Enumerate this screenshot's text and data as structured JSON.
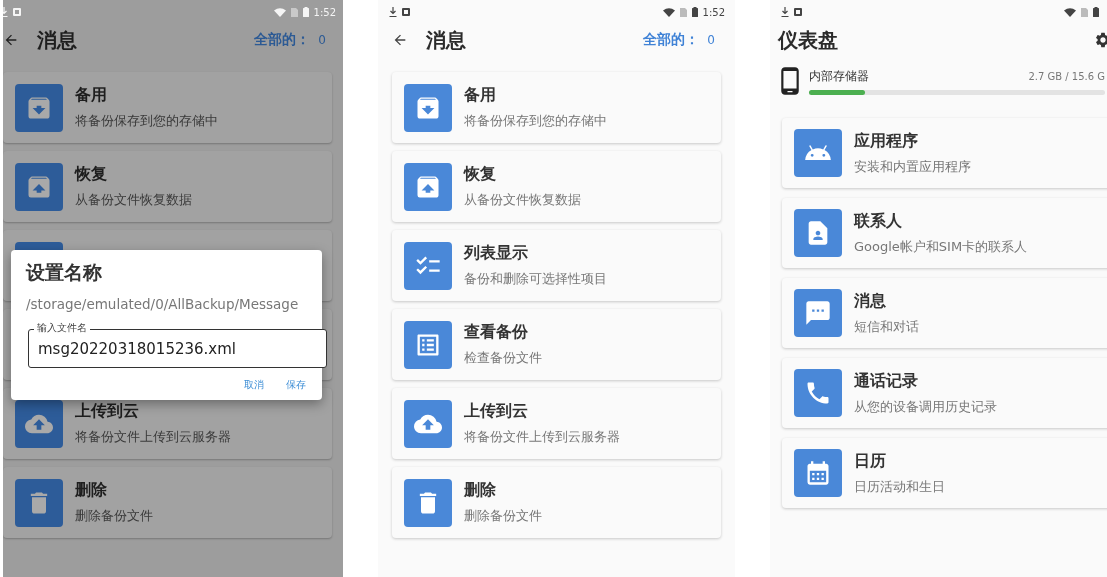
{
  "backup_screen_with_dialog": {
    "scrim": true,
    "status_bar": {
      "time": "1:52"
    },
    "header": {
      "title": "消息",
      "total_label": "全部的：",
      "total_value": "0"
    },
    "cards_above": [
      {
        "kind": "backup",
        "title": "备用",
        "subtitle": "将备份保存到您的存储中"
      },
      {
        "kind": "restore",
        "title": "恢复",
        "subtitle": "从备份文件恢复数据"
      }
    ],
    "cards_below": [
      {
        "kind": "upload",
        "title": "上传到云",
        "subtitle": "将备份文件上传到云服务器"
      },
      {
        "kind": "delete",
        "title": "删除",
        "subtitle": "删除备份文件"
      }
    ],
    "dialog": {
      "title": "设置名称",
      "path": "/storage/emulated/0/AllBackup/Message",
      "field": {
        "label": "输入文件名",
        "value": "msg20220318015236.xml"
      },
      "buttons": [
        "取消",
        "保存"
      ]
    }
  },
  "messages_screen": {
    "scrim": false,
    "status_bar": {
      "time": "1:52"
    },
    "header": {
      "title": "消息",
      "total_label": "全部的：",
      "total_value": "0"
    },
    "cards": [
      {
        "kind": "backup",
        "title": "备用",
        "subtitle": "将备份保存到您的存储中"
      },
      {
        "kind": "restore",
        "title": "恢复",
        "subtitle": "从备份文件恢复数据"
      },
      {
        "kind": "list",
        "title": "列表显示",
        "subtitle": "备份和删除可选择性项目"
      },
      {
        "kind": "view",
        "title": "查看备份",
        "subtitle": "检查备份文件"
      },
      {
        "kind": "upload",
        "title": "上传到云",
        "subtitle": "将备份文件上传到云服务器"
      },
      {
        "kind": "delete",
        "title": "删除",
        "subtitle": "删除备份文件"
      }
    ]
  },
  "dashboard_screen": {
    "title": "仪表盘",
    "storage": {
      "label": "内部存储器",
      "usage": "2.7 GB / 15.6 G",
      "level": 0.19
    },
    "cards": [
      {
        "kind": "apps",
        "title": "应用程序",
        "subtitle": "安装和内置应用程序"
      },
      {
        "kind": "contacts",
        "title": "联系人",
        "subtitle": "Google帐户和SIM卡的联系人"
      },
      {
        "kind": "messages",
        "title": "消息",
        "subtitle": "短信和对话"
      },
      {
        "kind": "calls",
        "title": "通话记录",
        "subtitle": "从您的设备调用历史记录"
      },
      {
        "kind": "calendar",
        "title": "日历",
        "subtitle": "日历活动和生日"
      }
    ]
  }
}
